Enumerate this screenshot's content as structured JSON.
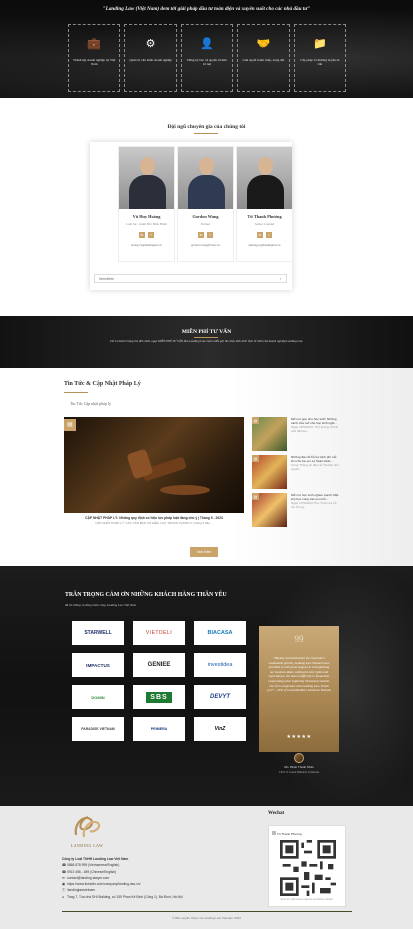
{
  "hero": {
    "title": "\"Landing Law (Việt Nam) đem tới giải pháp đầu tư toàn diện và xuyên suốt cho các nhà đầu tư\"",
    "cards": [
      {
        "icon": "briefcase-icon",
        "glyph": "💼",
        "text": "Thành lập doanh nghiệp tại Việt Nam"
      },
      {
        "icon": "briefcase-gear-icon",
        "glyph": "⚙",
        "text": "Quản trị vận hành doanh nghiệp"
      },
      {
        "icon": "user-shield-icon",
        "glyph": "👤",
        "text": "Đăng ký bảo vệ quyền sở hữu trí tuệ"
      },
      {
        "icon": "handshake-icon",
        "glyph": "🤝",
        "text": "Giải quyết tranh chấp, xung đột"
      },
      {
        "icon": "folder-icon",
        "glyph": "📁",
        "text": "Cấp phép và thường xuyên tư vấn"
      }
    ]
  },
  "experts": {
    "title": "Đội ngũ chuyên gia của chúng tôi",
    "people": [
      {
        "name": "Vũ Huy Hoàng",
        "role": "Luật Sư - Giám Đốc Điều Hành",
        "email": "hoang.vu@landinglaw.vn"
      },
      {
        "name": "Gordon Wang",
        "role": "Partner",
        "email": "gordon.wang@lvlaw.vn"
      },
      {
        "name": "Từ Thanh Phương",
        "role": "Senior Counsel",
        "email": "phuong.tu@landinglaw.vn"
      }
    ],
    "social_labels": [
      "in",
      "f"
    ],
    "more_label": "Xem thêm",
    "more_chevron": "›"
  },
  "consult": {
    "title": "MIỄN PHÍ TƯ VẤN",
    "subtitle": "Để trợ khách hàng tìm đến nhất, ngay MIỄN PHÍ TƯ VẤN đầu Landing Law mình miễn phí tìm hiểu kiến thức thực tế nhất của doanh nghiệp Landing Law"
  },
  "news": {
    "title": "Tin Tức & Cập Nhật Pháp Lý",
    "subtitle": "Tin Tức Cập nhật pháp lý",
    "main_tag": "▤",
    "main_caption": "CẬP NHẬT PHÁP LÝ: Những quy định có hiệu lực pháp luật đáng chú ý | Tháng 5 - 2023",
    "main_meta": "CẬP NHẬT PHÁP LÝ: CÁC VĂN BẢN CÓ HIỆU LỰC TRONG THÁNG 5 | tháng 5 đến...",
    "side": [
      {
        "tag": "▤",
        "title": "Mở mơ gọn cho học sinh: Những cánh cửa mở cho học sinh ngồi...",
        "meta": "Ngày 16/5/2023, Thủ tướng Chính phủ đã ban..."
      },
      {
        "tag": "▤",
        "title": "Những địa chỉ hỗ trợ kinh phí mở lớn cho trẻ em có hoàn cảnh...",
        "meta": "Công Thông tin điện tử Hà Nội như quyết..."
      },
      {
        "tag": "▤",
        "title": "Mở mơ học sinh nghèo mạnh: Một lớp học cùng các em nhỏ...",
        "meta": "Ngày 17/5/2023 Thư Tước tra hỗ trợ Trung..."
      }
    ],
    "more_label": "Xem thêm"
  },
  "clients": {
    "title": "TRÂN TRỌNG CẢM ƠN NHỮNG KHÁCH HÀNG THÂN YÊU",
    "subtitle": "đã tin tưởng và đồng hành cùng Landing Law Việt Nam",
    "logos": [
      {
        "name": "STARWELL",
        "color": "#1f2d6b"
      },
      {
        "name": "VIETDELI",
        "color": "#c23a2a"
      },
      {
        "name": "BIACASA",
        "color": "#1a7bb9"
      },
      {
        "name": "IMPACTUS",
        "color": "#1a2d5e"
      },
      {
        "name": "GENIEE",
        "color": "#222222"
      },
      {
        "name": "investidea",
        "color": "#1f5da8"
      },
      {
        "name": "DOMIN",
        "color": "#2f8a3a"
      },
      {
        "name": "SBS",
        "color": "#ffffff"
      },
      {
        "name": "DEVYT",
        "color": "#1f3f8a"
      },
      {
        "name": "PARADISE VIETNAM",
        "color": "#444444"
      },
      {
        "name": "PRIMERA",
        "color": "#1a3d7a"
      },
      {
        "name": "VinZ",
        "color": "#111111"
      }
    ],
    "testimonial": {
      "number": "99",
      "text": "\"Having consulted about the corporate's sustainable growth, Landing Law Vietnam have provided us with great support in strengthening our business ideas, setting the best rights and expectations. We had no difficulty in financially cooperating when exploring Vietnamese market. Our firm cooperates with Landing Law. Thank you!\" - CEO of Grand Builders Solutions Vietnam",
      "stars": "★★★★★",
      "name": "Ms. Phạm Thanh Nhàn",
      "role": "CEO of Grand Builders Solutions"
    }
  },
  "footer": {
    "brand": "LANDING LAW",
    "company": "Công ty Luật TNHH Landing Law Việt Nam",
    "lines": [
      {
        "icon": "phone-icon",
        "glyph": "☎",
        "text": "0868 878 995 (Vietnamese/English)"
      },
      {
        "icon": "phone-icon",
        "glyph": "☎",
        "text": "0913 456 - 489 (Chinese/English)"
      },
      {
        "icon": "mail-icon",
        "glyph": "✉",
        "text": "contact@landing-lawyer.com"
      },
      {
        "icon": "linkedin-icon",
        "glyph": "▣",
        "text": "https://www.linkedin.com/company/landing-law-vn/"
      },
      {
        "icon": "facebook-icon",
        "glyph": "ⓕ",
        "text": "/landinglawvietnam"
      },
      {
        "icon": "home-icon",
        "glyph": "⌂",
        "text": "Tầng 7, Tòa nhà SHI Building, số 159 Phan Kế Bính (Cống 1), Ba Đình, Hà Nội"
      }
    ],
    "wechat_title": "Wechat",
    "qr_name": "Từ Thanh Phương",
    "qr_foot": "Scan the QR code to add me as Weixin contact.",
    "copyright": "© Bản quyền thuộc về Landing Law Vietnam 2023"
  }
}
